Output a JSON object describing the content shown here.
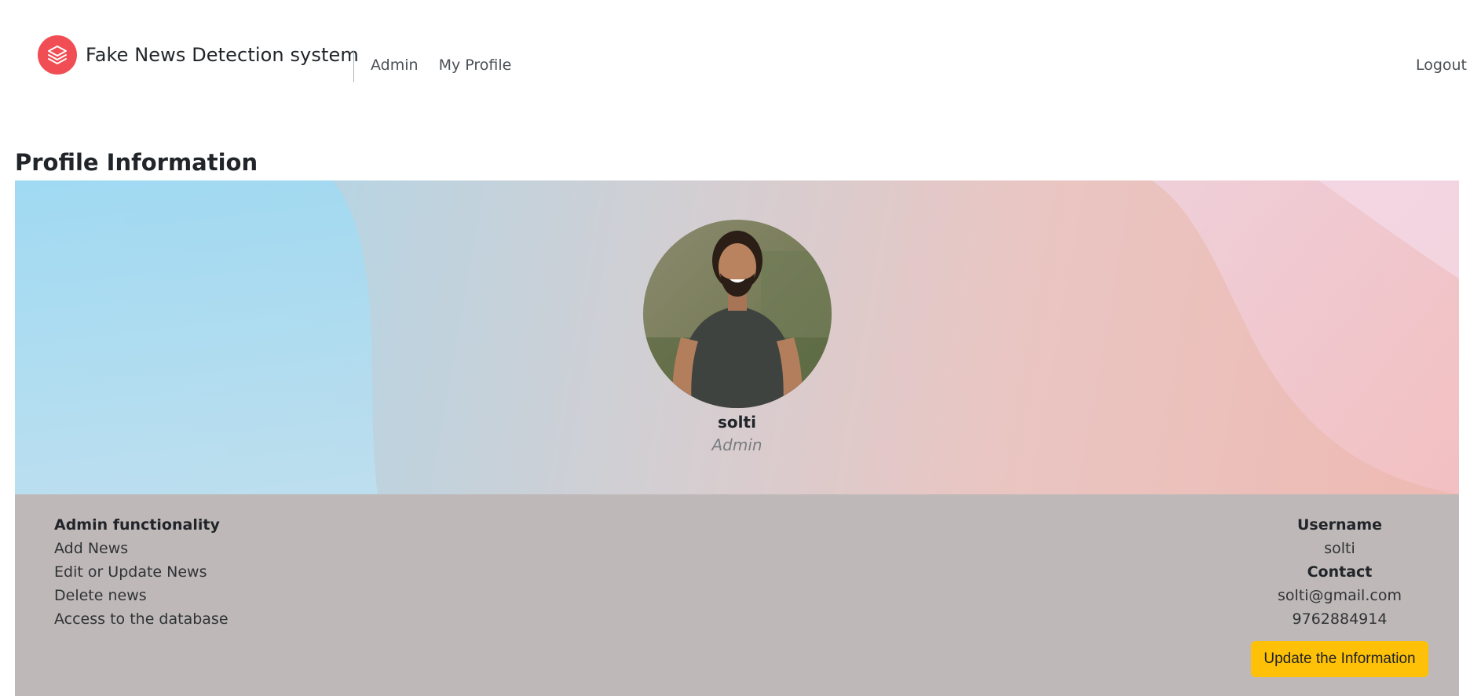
{
  "brand": {
    "name": "Fake News Detection system",
    "logo_icon": "layers-icon",
    "logo_color": "#f04e54"
  },
  "nav": {
    "items": [
      {
        "label": "Admin"
      },
      {
        "label": "My Profile"
      }
    ],
    "logout_label": "Logout"
  },
  "page": {
    "title": "Profile Information"
  },
  "profile": {
    "name": "solti",
    "role": "Admin"
  },
  "functionality": {
    "heading": "Admin functionality",
    "items": [
      {
        "label": "Add News"
      },
      {
        "label": "Edit or Update News"
      },
      {
        "label": "Delete news"
      },
      {
        "label": "Access to the database"
      }
    ]
  },
  "account": {
    "username_heading": "Username",
    "username": "solti",
    "contact_heading": "Contact",
    "email": "solti@gmail.com",
    "phone": "9762884914",
    "update_button_label": "Update the Information",
    "update_button_color": "#ffc107"
  }
}
